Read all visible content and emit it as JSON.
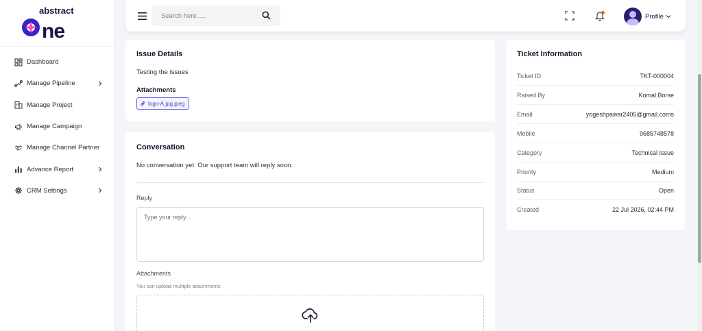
{
  "brand": {
    "logo_top": "abstract",
    "logo_bottom": "one",
    "accent": "#4b2bd6"
  },
  "sidebar": {
    "items": [
      {
        "label": "Dashboard",
        "icon": "dashboard-grid-icon",
        "has_submenu": false
      },
      {
        "label": "Manage Pipeline",
        "icon": "pipeline-icon",
        "has_submenu": true
      },
      {
        "label": "Manage Project",
        "icon": "building-icon",
        "has_submenu": false
      },
      {
        "label": "Manage Campaign",
        "icon": "megaphone-icon",
        "has_submenu": false
      },
      {
        "label": "Manage Channel Partner",
        "icon": "handshake-icon",
        "has_submenu": false
      },
      {
        "label": "Advance Report",
        "icon": "bar-chart-icon",
        "has_submenu": true
      },
      {
        "label": "CRM Settings",
        "icon": "gear-icon",
        "has_submenu": true
      }
    ]
  },
  "header": {
    "search_placeholder": "Search here.....",
    "profile_label": "Profile",
    "notification_dot_color": "#f05a28"
  },
  "issue": {
    "title": "Issue Details",
    "description": "Testing the issues",
    "attachments_label": "Attachments",
    "attachment_name": "logo-A.jpg.jpeg"
  },
  "conversation": {
    "title": "Conversation",
    "empty_message": "No conversation yet. Our support team will reply soon.",
    "reply_label": "Reply",
    "reply_placeholder": "Type your reply...",
    "attachments_label": "Attachments",
    "attachments_hint": "You can upload multiple attachments."
  },
  "ticket": {
    "title": "Ticket Information",
    "rows": [
      {
        "label": "Ticket ID",
        "value": "TKT-000004"
      },
      {
        "label": "Raised By",
        "value": "Komal Borse"
      },
      {
        "label": "Email",
        "value": "yogeshpawar2405@gmail.coms"
      },
      {
        "label": "Mobile",
        "value": "9685748578"
      },
      {
        "label": "Category",
        "value": "Technical Issue"
      },
      {
        "label": "Priority",
        "value": "Medium"
      },
      {
        "label": "Status",
        "value": "Open"
      },
      {
        "label": "Created",
        "value": "22 Jul 2026, 02:44 PM"
      }
    ]
  }
}
